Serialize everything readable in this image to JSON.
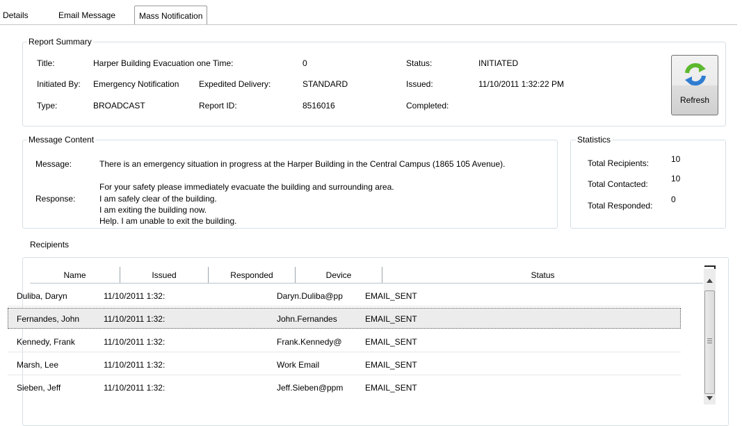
{
  "tabs": [
    {
      "label": "Details"
    },
    {
      "label": "Email Message"
    },
    {
      "label": "Mass Notification"
    }
  ],
  "report_summary": {
    "legend": "Report Summary",
    "title_label": "Title:",
    "title_value": "Harper Building Evacuation one Time:",
    "time_value": "0",
    "status_label": "Status:",
    "status_value": "INITIATED",
    "initiated_by_label": "Initiated By:",
    "initiated_by_value": "Emergency Notification",
    "expedited_label": "Expedited Delivery:",
    "expedited_value": "STANDARD",
    "issued_label": "Issued:",
    "issued_value": "11/10/2011 1:32:22 PM",
    "type_label": "Type:",
    "type_value": "BROADCAST",
    "report_id_label": "Report ID:",
    "report_id_value": "8516016",
    "completed_label": "Completed:",
    "refresh_label": "Refresh"
  },
  "message_content": {
    "legend": "Message Content",
    "message_label": "Message:",
    "message_line1": "There is an emergency situation in progress at the Harper Building in the Central Campus (1865 105 Avenue).",
    "message_line2": "For your safety please immediately evacuate the building and surrounding area.",
    "response_label": "Response:",
    "responses": [
      "I am safely clear of the building.",
      "I am exiting the building now.",
      "Help. I am unable to exit the building."
    ]
  },
  "statistics": {
    "legend": "Statistics",
    "total_recipients_label": "Total Recipients:",
    "total_recipients_value": "10",
    "total_contacted_label": "Total Contacted:",
    "total_contacted_value": "10",
    "total_responded_label": "Total Responded:",
    "total_responded_value": "0"
  },
  "recipients": {
    "label": "Recipients",
    "columns": [
      "Name",
      "Issued",
      "Responded",
      "Device",
      "Status"
    ],
    "rows": [
      {
        "name": "Duliba, Daryn",
        "issued": "11/10/2011 1:32:",
        "responded": "",
        "device": "Daryn.Duliba@pp",
        "status": "EMAIL_SENT"
      },
      {
        "name": "Fernandes, John",
        "issued": "11/10/2011 1:32:",
        "responded": "",
        "device": "John.Fernandes",
        "status": "EMAIL_SENT"
      },
      {
        "name": "Kennedy, Frank",
        "issued": "11/10/2011 1:32:",
        "responded": "",
        "device": "Frank.Kennedy@",
        "status": "EMAIL_SENT"
      },
      {
        "name": "Marsh, Lee",
        "issued": "11/10/2011 1:32:",
        "responded": "",
        "device": "Work Email",
        "status": "EMAIL_SENT"
      },
      {
        "name": "Sieben, Jeff",
        "issued": "11/10/2011 1:32:",
        "responded": "",
        "device": "Jeff.Sieben@ppm",
        "status": "EMAIL_SENT"
      }
    ]
  },
  "icons": {
    "refresh": "refresh-icon",
    "scroll_up": "scroll-up-arrow-icon",
    "scroll_down": "scroll-down-arrow-icon"
  }
}
